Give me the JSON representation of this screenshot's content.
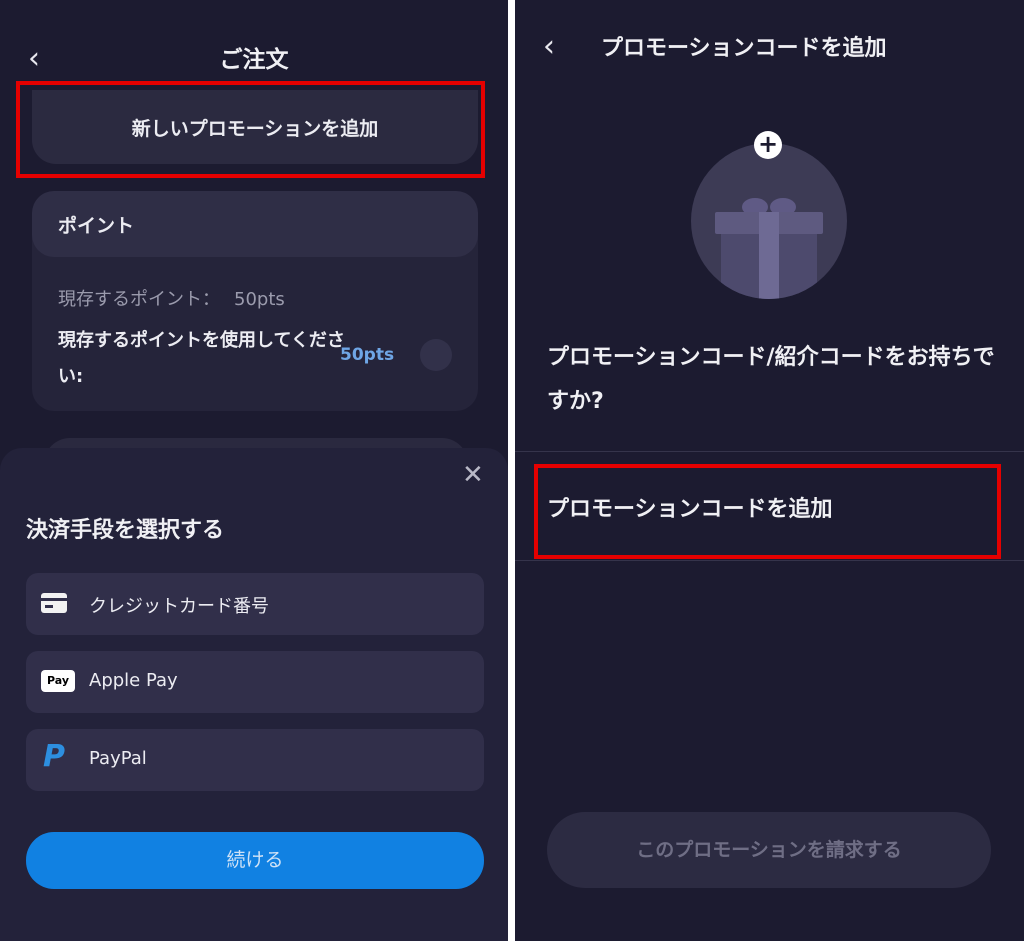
{
  "left": {
    "header": {
      "back_icon": "‹",
      "title": "ご注文"
    },
    "promo": {
      "label": "新しいプロモーションを追加"
    },
    "points": {
      "header": "ポイント",
      "owned_label": "現存するポイント：",
      "owned_value": "50pts",
      "use_label": "現存するポイントを使用してください:",
      "use_value": "50pts"
    },
    "payment_sheet": {
      "close_icon": "✕",
      "title": "決済手段を選択する",
      "options": [
        {
          "label": "クレジットカード番号",
          "icon": "credit-card-icon"
        },
        {
          "label": "Apple Pay",
          "icon": "apple-pay-icon",
          "badge": "Pay"
        },
        {
          "label": "PayPal",
          "icon": "paypal-icon",
          "glyph": "P"
        }
      ],
      "continue_label": "続ける"
    }
  },
  "right": {
    "header": {
      "back_icon": "‹",
      "title": "プロモーションコードを追加"
    },
    "plus_icon": "+",
    "question": "プロモーションコード/紹介コードをお持ちですか?",
    "add_promo_label": "プロモーションコードを追加",
    "claim_label": "このプロモーションを請求する"
  },
  "colors": {
    "background": "#1c1b30",
    "card": "#25243a",
    "highlight_border": "#e50000",
    "primary_button": "#1181e2",
    "points_accent": "#6fa6e6"
  }
}
